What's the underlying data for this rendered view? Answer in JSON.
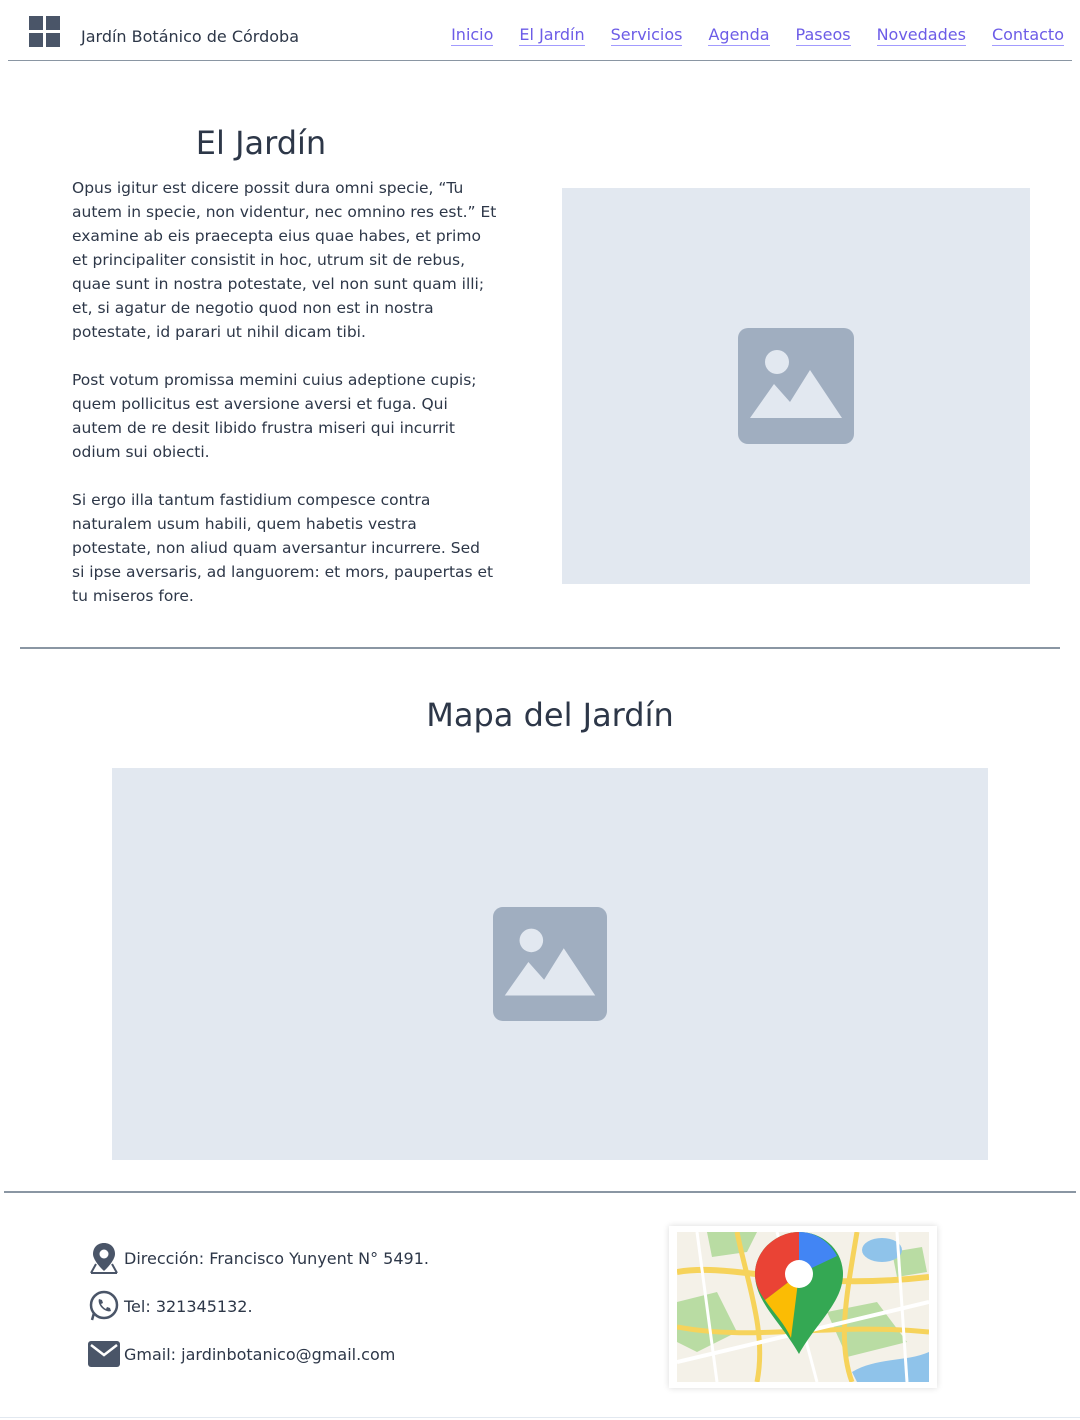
{
  "header": {
    "site_title": "Jardín Botánico de Córdoba",
    "nav": [
      "Inicio",
      "El Jardín",
      "Servicios",
      "Agenda",
      "Paseos",
      "Novedades",
      "Contacto"
    ]
  },
  "section_garden": {
    "title": "El Jardín",
    "paragraphs": [
      "Opus igitur est dicere possit dura omni specie, “Tu autem in specie, non videntur, nec omnino res est.” Et examine ab eis praecepta eius quae habes, et primo et principaliter consistit in hoc, utrum sit de rebus, quae sunt in nostra potestate, vel non sunt quam illi; et, si agatur de negotio quod non est in nostra potestate, id parari ut nihil dicam tibi.",
      "Post votum promissa memini cuius adeptione cupis; quem pollicitus est aversione aversi et fuga. Qui autem de re desit libido frustra miseri qui incurrit odium sui obiecti.",
      "Si ergo illa tantum fastidium compesce contra naturalem usum habili, quem habetis vestra potestate, non aliud quam aversantur incurrere. Sed si ipse aversaris, ad languorem: et mors, paupertas et tu miseros fore."
    ]
  },
  "section_map": {
    "title": "Mapa del Jardín"
  },
  "footer": {
    "address": "Dirección: Francisco Yunyent N° 5491.",
    "phone": "Tel: 321345132.",
    "email": "Gmail: jardinbotanico@gmail.com"
  },
  "icons": {
    "logo": "grid-logo-icon",
    "placeholder": "image-placeholder-icon",
    "address": "location-pin-icon",
    "phone": "whatsapp-icon",
    "email": "mail-icon",
    "map": "google-maps-icon"
  },
  "colors": {
    "nav_link": "#6c5ce7",
    "text": "#2d3748",
    "placeholder_bg": "#e2e8f0",
    "placeholder_icon": "#a0aec0",
    "divider": "#8a96a3"
  }
}
